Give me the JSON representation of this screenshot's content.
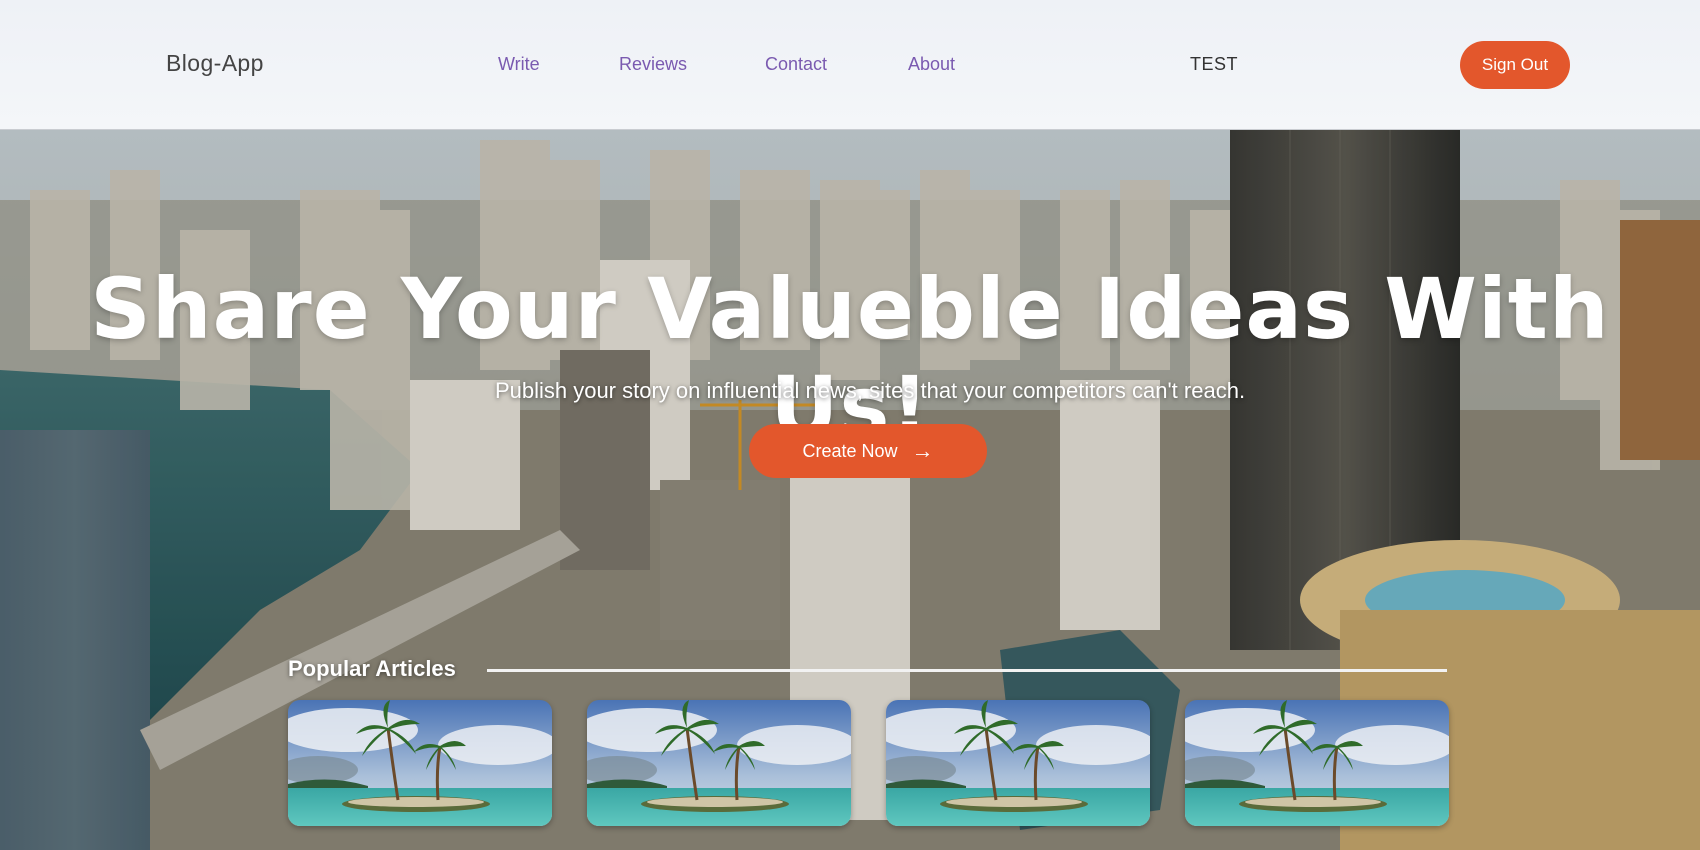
{
  "navbar": {
    "brand": "Blog-App",
    "links": [
      {
        "label": "Write"
      },
      {
        "label": "Reviews"
      },
      {
        "label": "Contact"
      },
      {
        "label": "About"
      }
    ],
    "user": "TEST",
    "signout_label": "Sign Out"
  },
  "hero": {
    "headline": "Share Your Valueble Ideas With Us!",
    "subline": "Publish your story on influential news, sites that your competitors can't reach.",
    "cta_label": "Create Now",
    "cta_icon": "arrow-right-icon"
  },
  "popular": {
    "title": "Popular Articles",
    "cards": [
      {
        "image": "palm-island-image"
      },
      {
        "image": "palm-island-image"
      },
      {
        "image": "palm-island-image"
      },
      {
        "image": "palm-island-image"
      }
    ]
  },
  "colors": {
    "accent": "#e3572c",
    "nav_link": "#7a5ab0",
    "navbar_bg": "#eef1f6"
  }
}
